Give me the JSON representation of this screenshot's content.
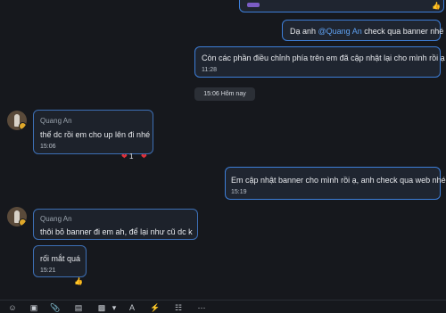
{
  "messages": {
    "m1": {
      "prefix": "Dạ anh ",
      "mention": "@Quang An",
      "suffix": " check qua banner nhé"
    },
    "m2": {
      "text": "Còn các phần điều chỉnh phía trên em đã cập nhật lại cho mình rồi ạ",
      "time": "11:28"
    },
    "divider": "15:06 Hôm nay",
    "m3": {
      "sender": "Quang An",
      "text": "thế dc rồi em cho up lên đi nhé",
      "time": "15:06",
      "reaction_count": "1"
    },
    "m4": {
      "text": "Em cập nhật banner cho mình rồi ạ, anh check qua web nhé",
      "time": "15:19"
    },
    "m5": {
      "sender": "Quang An",
      "text": "thôi bỏ banner đi em ah, để lại như cũ dc k"
    },
    "m6": {
      "text": "rối mắt quá",
      "time": "15:21"
    }
  },
  "icons": {
    "reaction_heart": "heart-icon",
    "like": "thumbs-up-icon"
  },
  "colors": {
    "background": "#16181d",
    "bubble_border": "#3d7ed8",
    "mention": "#5ea0f0",
    "heart": "#e0303a"
  }
}
